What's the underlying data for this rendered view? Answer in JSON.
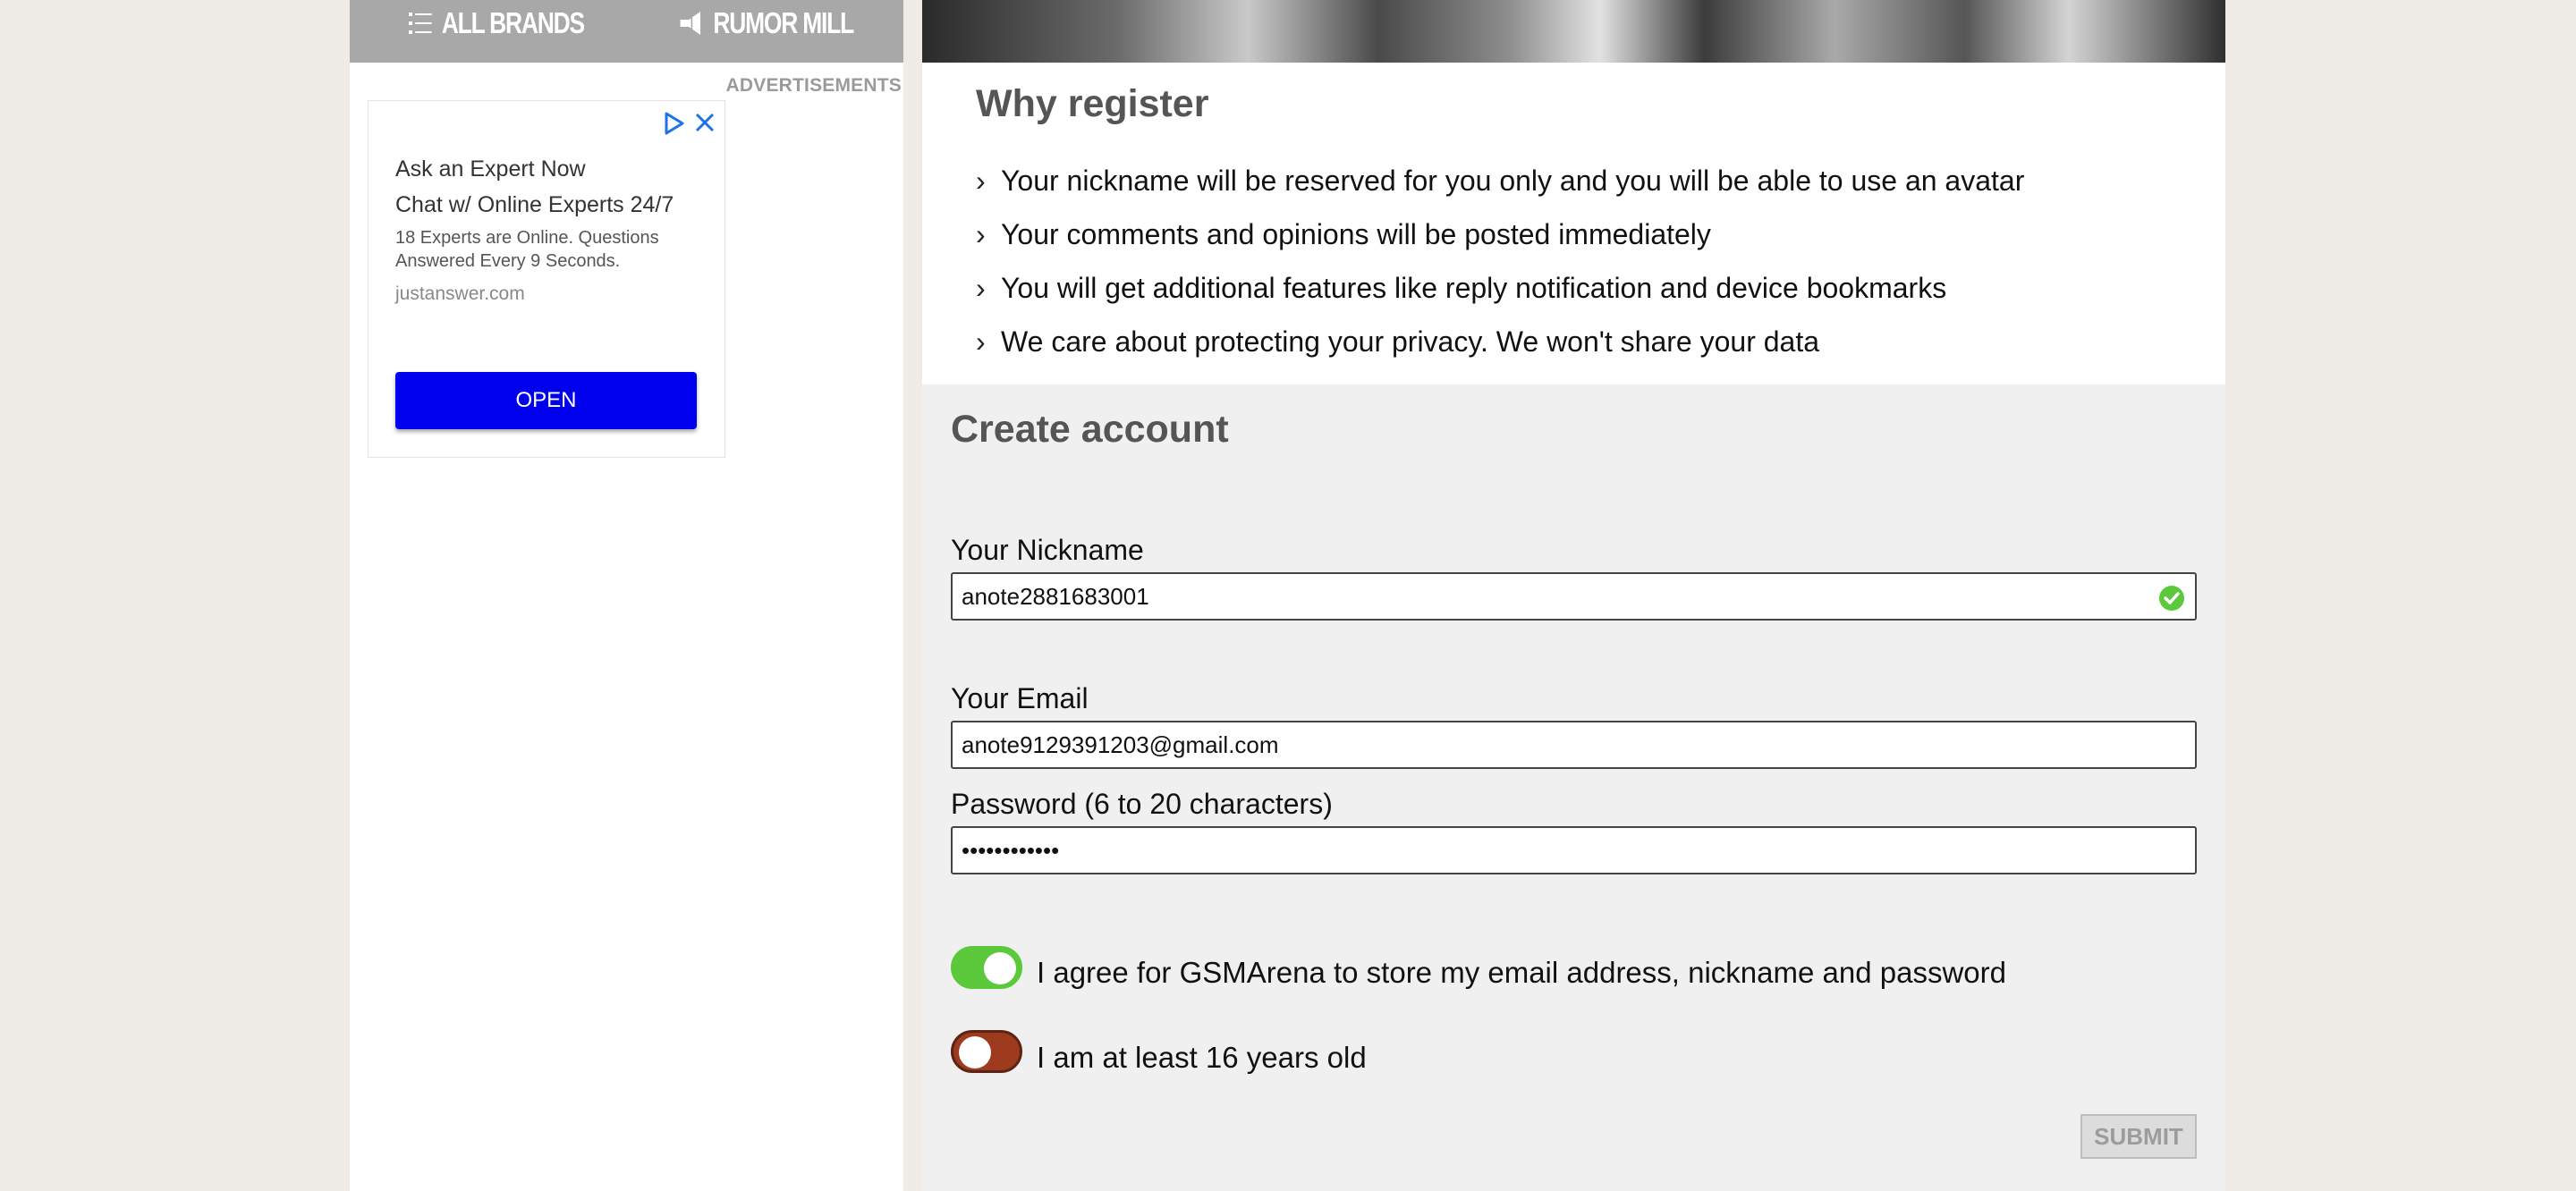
{
  "nav": {
    "all_brands": "ALL BRANDS",
    "rumor_mill": "RUMOR MILL"
  },
  "ads": {
    "label": "ADVERTISEMENTS",
    "title": "Ask an Expert Now",
    "subtitle": "Chat w/ Online Experts 24/7",
    "description": "18 Experts are Online. Questions Answered Every 9 Seconds.",
    "domain": "justanswer.com",
    "button": "OPEN",
    "button_color": "#0000ee"
  },
  "why": {
    "title": "Why register",
    "items": [
      "Your nickname will be reserved for you only and you will be able to use an avatar",
      "Your comments and opinions will be posted immediately",
      "You will get additional features like reply notification and device bookmarks",
      "We care about protecting your privacy. We won't share your data"
    ]
  },
  "form": {
    "title": "Create account",
    "nickname_label": "Your Nickname",
    "nickname_value": "anote2881683001",
    "email_label": "Your Email",
    "email_value": "anote9129391203@gmail.com",
    "password_label": "Password (6 to 20 characters)",
    "password_value": "••••••••••••",
    "agree_label": "I agree for GSMArena to store my email address, nickname and password",
    "agree_checked": true,
    "age_label": "I am at least 16 years old",
    "age_checked": false,
    "submit": "SUBMIT",
    "colors": {
      "toggle_on": "#5cc93d",
      "toggle_off": "#9e3b1f",
      "valid_check": "#5cc93d"
    }
  }
}
